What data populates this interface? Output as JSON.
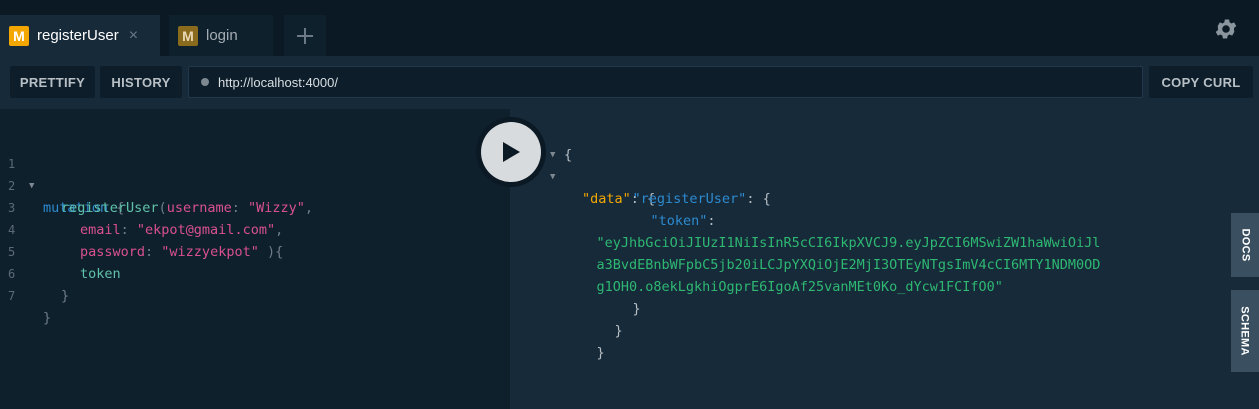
{
  "tabs": [
    {
      "badge": "M",
      "label": "registerUser",
      "close": "×",
      "active": true
    },
    {
      "badge": "M",
      "label": "login",
      "active": false
    }
  ],
  "toolbar": {
    "prettify": "PRETTIFY",
    "history": "HISTORY",
    "url": "http://localhost:4000/",
    "copy_curl": "COPY CURL"
  },
  "editor": {
    "line_numbers": [
      "1",
      "2",
      "3",
      "4",
      "5",
      "6",
      "7"
    ],
    "l1": {
      "kw": "mutation",
      "brace": " {"
    },
    "l2": {
      "fn": "registerUser",
      "open": "(",
      "arg": "username",
      "colon": ": ",
      "val": "\"Wizzy\"",
      "comma": ","
    },
    "l3": {
      "arg": "email",
      "colon": ": ",
      "val": "\"ekpot@gmail.com\"",
      "comma": ","
    },
    "l4": {
      "arg": "password",
      "colon": ": ",
      "val": "\"wizzyekpot\"",
      "close": " ){"
    },
    "l5": {
      "field": "token"
    },
    "l6": {
      "brace": "}"
    },
    "l7": {
      "brace": "}"
    }
  },
  "result": {
    "open": "{",
    "data_key": "\"data\"",
    "reg_key": "\"registerUser\"",
    "token_key": "\"token\"",
    "colon_brace": ": {",
    "colon": ":",
    "token_line1": "\"eyJhbGciOiJIUzI1NiIsInR5cCI6IkpXVCJ9.eyJpZCI6MSwiZW1haWwiOiJl",
    "token_line2": "a3BvdEBnbWFpbC5jb20iLCJpYXQiOjE2MjI3OTEyNTgsImV4cCI6MTY1NDM0OD",
    "token_line3": "g1OH0.o8ekLgkhiOgprE6IgoAf25vanMEt0Ko_dYcw1FCIfO0\"",
    "close": "}"
  },
  "side_tabs": {
    "docs": "DOCS",
    "schema": "SCHEMA"
  },
  "icons": {
    "settings": "gear-icon",
    "add_tab": "plus-icon",
    "run": "play-icon"
  },
  "colors": {
    "badge": "#f4a700",
    "keyword": "#2d8bd0",
    "string": "#d9508f",
    "result_string": "#2eb872"
  }
}
